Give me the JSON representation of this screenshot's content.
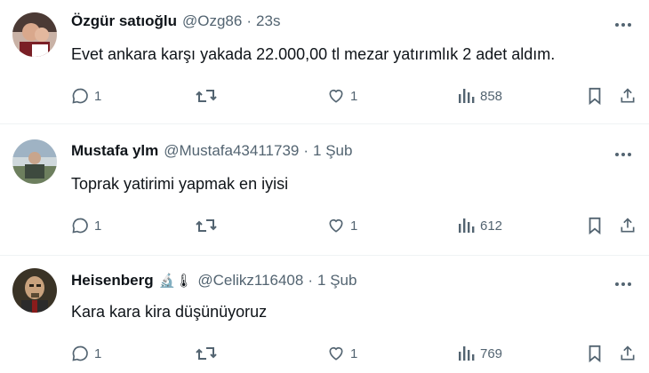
{
  "tweets": [
    {
      "name": "Özgür satıoğlu",
      "badge": "",
      "handle": "@Ozg86",
      "time": "23s",
      "text": "Evet ankara karşı yakada  22.000,00 tl mezar yatırımlık 2 adet aldım.",
      "replies": "1",
      "likes": "1",
      "views": "858"
    },
    {
      "name": "Mustafa ylm",
      "badge": "",
      "handle": "@Mustafa43411739",
      "time": "1 Şub",
      "text": "Toprak yatirimi yapmak en iyisi",
      "replies": "1",
      "likes": "1",
      "views": "612"
    },
    {
      "name": "Heisenberg",
      "badge": "🔬🌡",
      "handle": "@Celikz116408",
      "time": "1 Şub",
      "text": "Kara kara kira düşünüyoruz",
      "replies": "1",
      "likes": "1",
      "views": "769"
    }
  ],
  "separator": "·",
  "icons": {
    "more": "more-dots-icon",
    "reply": "reply-bubble-icon",
    "retweet": "retweet-icon",
    "like": "heart-icon",
    "views": "views-bars-icon",
    "bookmark": "bookmark-icon",
    "share": "share-icon"
  },
  "colors": {
    "text": "#0f1419",
    "secondary": "#536471",
    "divider": "#eff3f4"
  }
}
